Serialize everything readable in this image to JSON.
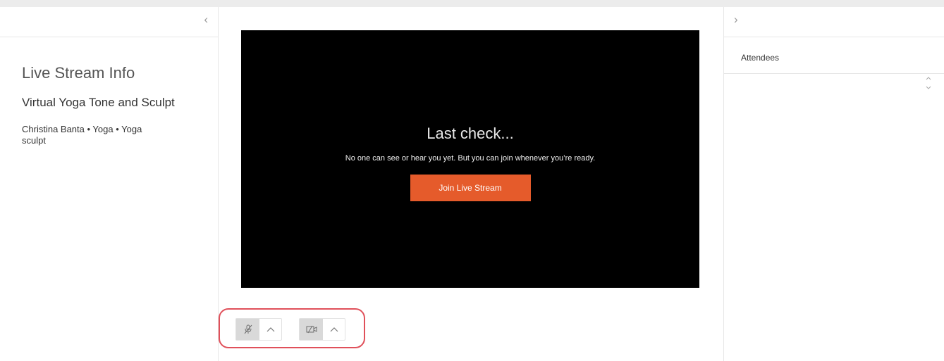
{
  "left_panel": {
    "collapse_glyph": "‹",
    "info_title": "Live Stream Info",
    "class_name": "Virtual Yoga Tone and Sculpt",
    "meta": "Christina Banta • Yoga • Yoga sculpt"
  },
  "stage": {
    "heading": "Last check...",
    "description": "No one can see or hear you yet. But you can join whenever you’re ready.",
    "join_label": "Join Live Stream",
    "join_color": "#e55b2b",
    "controls": {
      "highlight_color": "#e0505a",
      "mic_icon": "microphone-muted-icon",
      "camera_icon": "camera-off-icon",
      "chevron_icon": "chevron-up-icon"
    }
  },
  "right_panel": {
    "expand_glyph": "›",
    "attendees_label": "Attendees"
  }
}
